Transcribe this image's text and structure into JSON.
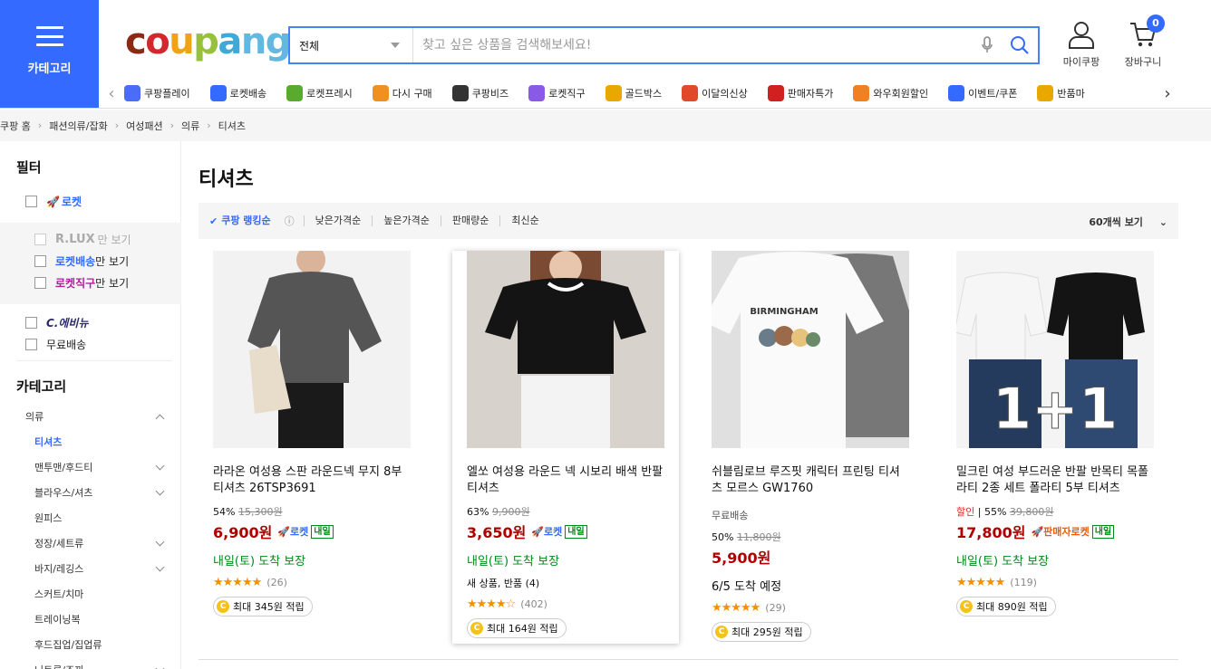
{
  "header": {
    "category_label": "카테고리",
    "logo": "coupang",
    "search_select": "전체",
    "search_placeholder": "찾고 싶은 상품을 검색해보세요!",
    "mypage_label": "마이쿠팡",
    "cart_label": "장바구니",
    "cart_count": "0",
    "accent_color": "#346aff"
  },
  "nav": [
    {
      "label": "쿠팡플레이",
      "icon": "play-icon",
      "color": "#4a6cf7"
    },
    {
      "label": "로켓배송",
      "icon": "rocket-icon",
      "color": "#346aff"
    },
    {
      "label": "로켓프레시",
      "icon": "rocket-fresh-icon",
      "color": "#5aaa30"
    },
    {
      "label": "다시 구매",
      "icon": "rebuy-icon",
      "color": "#f09020"
    },
    {
      "label": "쿠팡비즈",
      "icon": "biz-icon",
      "color": "#333333"
    },
    {
      "label": "로켓직구",
      "icon": "rocket-global-icon",
      "color": "#8a5ae6"
    },
    {
      "label": "골드박스",
      "icon": "goldbox-icon",
      "color": "#e8a800"
    },
    {
      "label": "이달의신상",
      "icon": "new-icon",
      "color": "#e04a2a"
    },
    {
      "label": "판매자특가",
      "icon": "percent-icon",
      "color": "#d02020"
    },
    {
      "label": "와우회원할인",
      "icon": "wow-icon",
      "color": "#f08020"
    },
    {
      "label": "이벤트/쿠폰",
      "icon": "coupon-icon",
      "color": "#346aff"
    },
    {
      "label": "반품마",
      "icon": "return-icon",
      "color": "#e8a800"
    }
  ],
  "breadcrumb": [
    "쿠팡 홈",
    "패션의류/잡화",
    "여성패션",
    "의류",
    "티셔츠"
  ],
  "filter": {
    "title": "필터",
    "rocket": "로켓",
    "rlux": "R.LUX",
    "rlux_suffix": "만 보기",
    "rocket_delivery": "로켓배송",
    "rocket_delivery_suffix": "만 보기",
    "rocket_global": "로켓직구",
    "rocket_global_suffix": "만 보기",
    "c_avenue": "C.에비뉴",
    "free_shipping": "무료배송"
  },
  "categories": {
    "title": "카테고리",
    "items": [
      {
        "label": "의류",
        "chev": "up",
        "active": false,
        "indent": 0
      },
      {
        "label": "티셔츠",
        "chev": "",
        "active": true,
        "indent": 1
      },
      {
        "label": "맨투맨/후드티",
        "chev": "down",
        "active": false,
        "indent": 1
      },
      {
        "label": "블라우스/셔츠",
        "chev": "down",
        "active": false,
        "indent": 1
      },
      {
        "label": "원피스",
        "chev": "",
        "active": false,
        "indent": 1
      },
      {
        "label": "정장/세트류",
        "chev": "down",
        "active": false,
        "indent": 1
      },
      {
        "label": "바지/레깅스",
        "chev": "down",
        "active": false,
        "indent": 1
      },
      {
        "label": "스커트/치마",
        "chev": "",
        "active": false,
        "indent": 1
      },
      {
        "label": "트레이닝복",
        "chev": "",
        "active": false,
        "indent": 1
      },
      {
        "label": "후드집업/집업류",
        "chev": "",
        "active": false,
        "indent": 1
      },
      {
        "label": "니트류/조끼",
        "chev": "down",
        "active": false,
        "indent": 1
      }
    ]
  },
  "main": {
    "title": "티셔츠",
    "sort": [
      "쿠팡 랭킹순",
      "낮은가격순",
      "높은가격순",
      "판매량순",
      "최신순"
    ],
    "per_page": "60개씩 보기"
  },
  "products": [
    {
      "name": "라라온 여성용 스판 라운드넥 무지 8부 티셔츠 26TSP3691",
      "ship_tag": "",
      "sale_prefix": "",
      "discount": "54%",
      "original": "15,300원",
      "price": "6,900원",
      "rocket": "로켓",
      "rocket_type": "normal",
      "tomorrow": "내일",
      "delivery": "내일(토) 도착 보장",
      "delivery_green": true,
      "extra": "",
      "stars": "★★★★★",
      "reviews": "(26)",
      "points": "최대 345원 적립",
      "img": "gray-tee"
    },
    {
      "name": "엘쏘 여성용 라운드 넥 시보리 배색 반팔 티셔츠",
      "ship_tag": "",
      "sale_prefix": "",
      "discount": "63%",
      "original": "9,900원",
      "price": "3,650원",
      "rocket": "로켓",
      "rocket_type": "normal",
      "tomorrow": "내일",
      "delivery": "내일(토) 도착 보장",
      "delivery_green": true,
      "extra": "새 상품, 반품 (4)",
      "stars": "★★★★☆",
      "reviews": "(402)",
      "points": "최대 164원 적립",
      "img": "black-tee"
    },
    {
      "name": "쉬블림로브 루즈핏 캐릭터 프린팅 티셔츠 모르스 GW1760",
      "ship_tag": "무료배송",
      "sale_prefix": "",
      "discount": "50%",
      "original": "11,800원",
      "price": "5,900원",
      "rocket": "",
      "rocket_type": "",
      "tomorrow": "",
      "delivery": "6/5 도착 예정",
      "delivery_green": false,
      "extra": "",
      "stars": "★★★★★",
      "reviews": "(29)",
      "points": "최대 295원 적립",
      "img": "white-print-tee",
      "print_text": "BIRMINGHAM"
    },
    {
      "name": "밀크린 여성 부드러운 반팔 반목티 목폴라티 2종 세트 폴라티 5부 티셔츠",
      "ship_tag": "",
      "sale_prefix": "할인",
      "discount": "55%",
      "original": "39,800원",
      "price": "17,800원",
      "rocket": "판매자로켓",
      "rocket_type": "seller",
      "tomorrow": "내일",
      "delivery": "내일(토) 도착 보장",
      "delivery_green": true,
      "extra": "",
      "stars": "★★★★★",
      "reviews": "(119)",
      "points": "최대 890원 적립",
      "img": "turtleneck-set",
      "overlay_text": "1+1"
    }
  ]
}
